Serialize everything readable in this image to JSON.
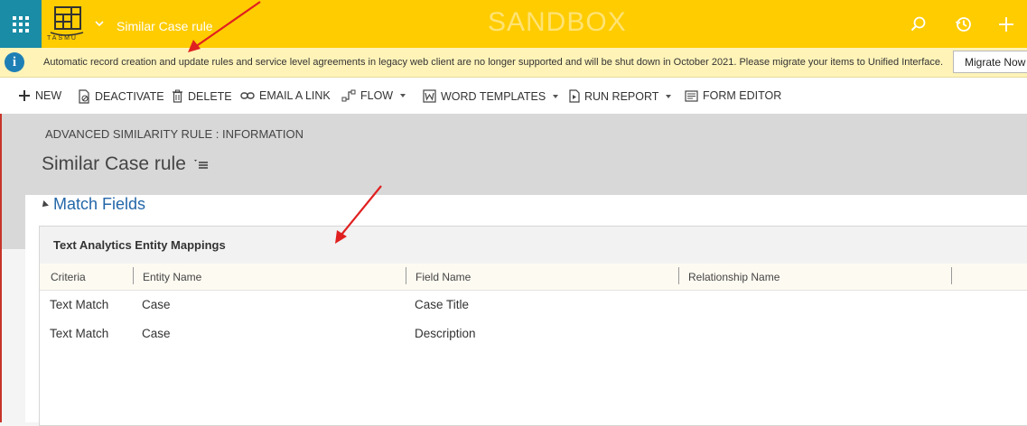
{
  "topbar": {
    "logo_text": "TASMU",
    "title": "Similar Case rule",
    "environment": "SANDBOX",
    "icons": [
      "search-icon",
      "recent-history-icon",
      "plus-icon"
    ],
    "colors": {
      "bar": "#ffcc00",
      "waffle": "#1a8ca6"
    }
  },
  "notification": {
    "text": "Automatic record creation and update rules and service level agreements in legacy web client are no longer supported and will be shut down in October 2021. Please migrate your items to Unified Interface.",
    "button": "Migrate Now"
  },
  "commands": [
    {
      "label": "NEW",
      "icon": "plus-icon"
    },
    {
      "label": "DEACTIVATE",
      "icon": "deactivate-icon"
    },
    {
      "label": "DELETE",
      "icon": "trash-icon"
    },
    {
      "label": "EMAIL A LINK",
      "icon": "link-icon"
    },
    {
      "label": "FLOW",
      "icon": "flow-icon",
      "dropdown": true
    },
    {
      "label": "WORD TEMPLATES",
      "icon": "word-icon",
      "dropdown": true
    },
    {
      "label": "RUN REPORT",
      "icon": "report-icon",
      "dropdown": true
    },
    {
      "label": "FORM EDITOR",
      "icon": "form-editor-icon"
    }
  ],
  "header": {
    "entity_label": "ADVANCED SIMILARITY RULE : INFORMATION",
    "record_name": "Similar Case rule"
  },
  "section": {
    "title": "Match Fields",
    "grid": {
      "title": "Text Analytics Entity Mappings",
      "columns": [
        "Criteria",
        "Entity Name",
        "Field Name",
        "Relationship Name"
      ],
      "rows": [
        [
          "Text Match",
          "Case",
          "Case Title",
          ""
        ],
        [
          "Text Match",
          "Case",
          "Description",
          ""
        ]
      ]
    }
  },
  "annotation_color": "#e02020"
}
